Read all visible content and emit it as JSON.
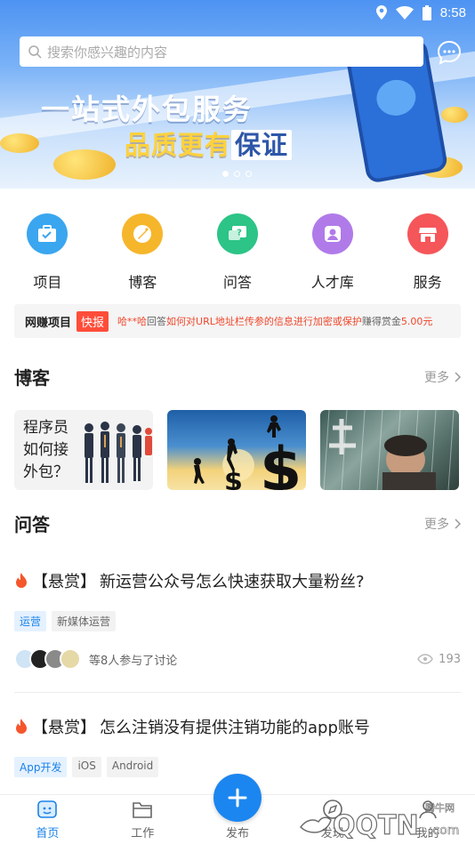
{
  "status": {
    "time": "8:58"
  },
  "search": {
    "placeholder": "搜索你感兴趣的内容"
  },
  "banner": {
    "title": "一站式外包服务",
    "subtitle_part1": "品质更有",
    "subtitle_part2": "保证"
  },
  "nav": [
    {
      "label": "项目",
      "icon": "project-icon",
      "color": "#3aa6ef"
    },
    {
      "label": "博客",
      "icon": "blog-icon",
      "color": "#f6b62b"
    },
    {
      "label": "问答",
      "icon": "qa-icon",
      "color": "#2cc487"
    },
    {
      "label": "人才库",
      "icon": "talent-icon",
      "color": "#b07be9"
    },
    {
      "label": "服务",
      "icon": "service-icon",
      "color": "#f5565a"
    }
  ],
  "notice": {
    "title": "网赚项目",
    "tag": "快报",
    "user": "哈**哈",
    "verb": "回答",
    "question": "如何对URL地址栏传参的信息进行加密或保护",
    "earned": "赚得赏金",
    "amount": "5.00元"
  },
  "blog": {
    "title": "博客",
    "more": "更多",
    "card1_text_line1": "程序员",
    "card1_text_line2": "如何接",
    "card1_text_line3": "外包？"
  },
  "qa": {
    "title": "问答",
    "more": "更多",
    "items": [
      {
        "prefix": "【悬赏】",
        "question": "新运营公众号怎么快速获取大量粉丝?",
        "tags": [
          "运营",
          "新媒体运营"
        ],
        "participants": "等8人参与了讨论",
        "views": "193"
      },
      {
        "prefix": "【悬赏】",
        "question": "怎么注销没有提供注销功能的app账号",
        "tags": [
          "App开发",
          "iOS",
          "Android"
        ]
      }
    ]
  },
  "tabs": [
    {
      "label": "首页",
      "active": true
    },
    {
      "label": "工作",
      "active": false
    },
    {
      "label": "发布",
      "active": false
    },
    {
      "label": "发现",
      "active": false
    },
    {
      "label": "我的",
      "active": false
    }
  ],
  "watermark": {
    "text": "QQTN",
    "domain": ".com",
    "sub": "腾牛网"
  },
  "colors": {
    "accent": "#1a82e8",
    "alert": "#f0472c",
    "fab": "#1b86f0"
  }
}
